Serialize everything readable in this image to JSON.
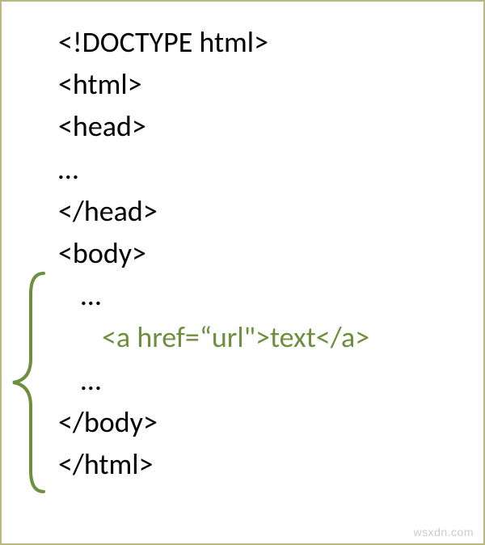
{
  "code": {
    "doctype": "<!DOCTYPE html>",
    "html_open": "<html>",
    "head_open": "<head>",
    "head_ellipsis": "…",
    "head_close": "</head>",
    "body_open": "<body>",
    "body_ellipsis_1": "…",
    "anchor": "<a href=“url\">text</a>",
    "body_ellipsis_2": "…",
    "body_close": "</body>",
    "html_close": "</html>"
  },
  "watermark": "wsxdn.com",
  "colors": {
    "highlight": "#6d8f3e",
    "border": "#b8b880",
    "text": "#000000"
  }
}
